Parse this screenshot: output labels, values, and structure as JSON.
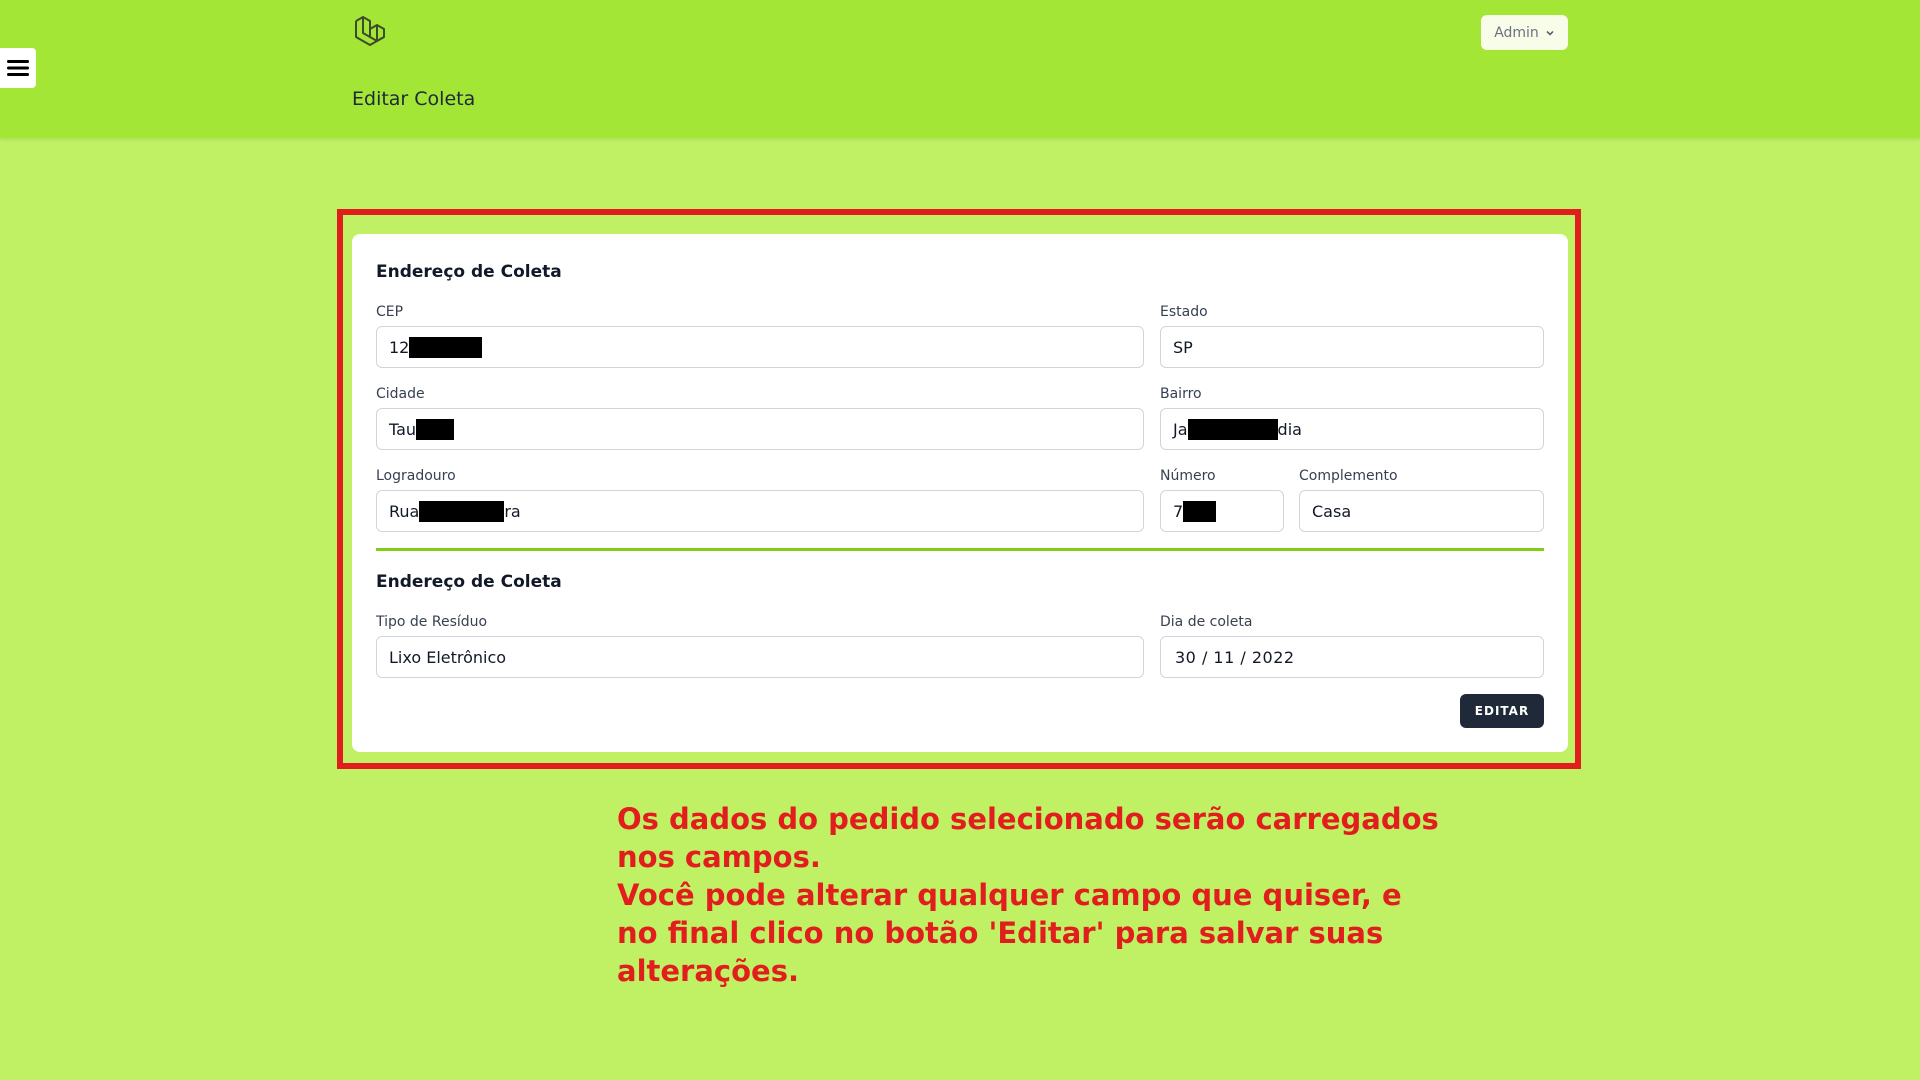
{
  "header": {
    "logo_icon": "laravel-logo-icon",
    "page_title": "Editar Coleta",
    "user_menu_label": "Admin",
    "menu_icon": "hamburger-menu-icon"
  },
  "form": {
    "address_section_title": "Endereço de Coleta",
    "cep": {
      "label": "CEP",
      "value_visible": "12",
      "redacted": true
    },
    "estado": {
      "label": "Estado",
      "value": "SP"
    },
    "cidade": {
      "label": "Cidade",
      "value_visible": "Tau",
      "redacted": true
    },
    "bairro": {
      "label": "Bairro",
      "value_prefix": "Ja",
      "value_suffix": "dia",
      "redacted": true
    },
    "logradouro": {
      "label": "Logradouro",
      "value_prefix": "Rua",
      "value_suffix": "ra",
      "redacted": true
    },
    "numero": {
      "label": "Número",
      "value_visible": "7",
      "redacted": true
    },
    "complemento": {
      "label": "Complemento",
      "value": "Casa"
    },
    "collection_section_title": "Endereço de Coleta",
    "tipo_residuo": {
      "label": "Tipo de Resíduo",
      "value": "Lixo Eletrônico"
    },
    "dia_coleta": {
      "label": "Dia de coleta",
      "value": "30 / 11 / 2022"
    },
    "submit_label": "EDITAR"
  },
  "annotation": {
    "lines": [
      "Os dados do pedido selecionado serão carregados",
      "nos campos.",
      "Você pode alterar qualquer campo que quiser, e",
      "no final clico no botão 'Editar' para salvar suas",
      "alterações."
    ]
  },
  "colors": {
    "header_bg": "#a3e635",
    "page_bg": "#c0f164",
    "highlight": "#e21d1d",
    "divider": "#84cc16",
    "button_bg": "#1f2937"
  }
}
